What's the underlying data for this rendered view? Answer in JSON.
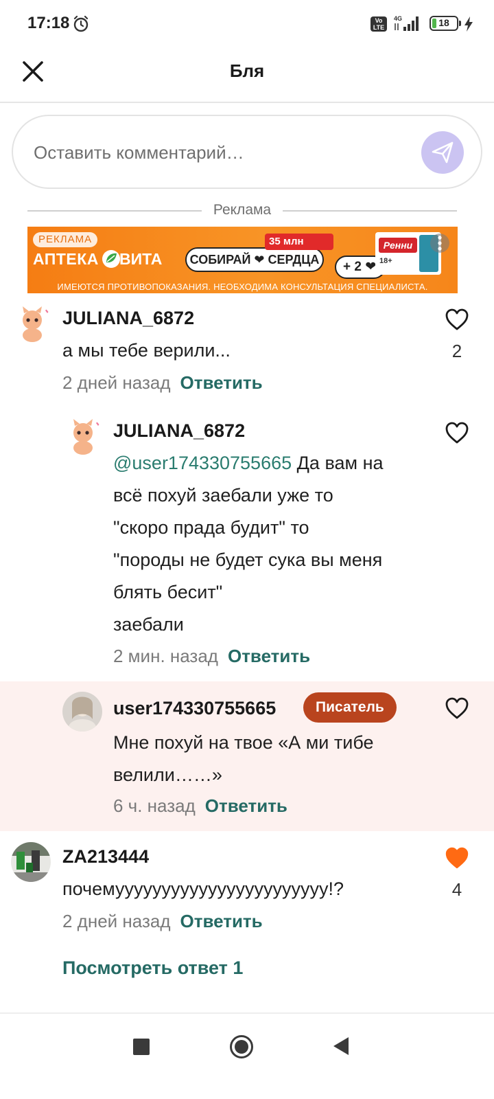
{
  "status_bar": {
    "time": "17:18",
    "network": "4G",
    "volte": "Vo LTE",
    "battery": "18",
    "battery_level": 0.18
  },
  "header": {
    "title": "Бля"
  },
  "comment_input": {
    "placeholder": "Оставить комментарий…"
  },
  "ad": {
    "caption": "Реклама",
    "badge": "РЕКЛАМА",
    "brand_left": "АПТЕКА",
    "brand_right": "ВИТА",
    "promo": "35 млн",
    "collect": "СОБИРАЙ ❤ СЕРДЦА",
    "plus": "+ 2 ❤",
    "product": "Ренни",
    "age": "18+",
    "disclaimer": "ИМЕЮТСЯ ПРОТИВОПОКАЗАНИЯ. НЕОБХОДИМА КОНСУЛЬТАЦИЯ СПЕЦИАЛИСТА."
  },
  "comments": [
    {
      "username": "JULIANA_6872",
      "text": "а мы тебе верили...",
      "time": "2 дней назад",
      "reply": "Ответить",
      "likes": "2"
    },
    {
      "username": "JULIANA_6872",
      "mention": "@user174330755665",
      "text_lines": [
        " Да вам на",
        "всё похуй заебали уже то",
        "\"скоро прада будит\" то",
        "\"породы не будет сука вы меня",
        "блять бесит\"",
        "заебали"
      ],
      "time": "2 мин. назад",
      "reply": "Ответить"
    },
    {
      "username": "user174330755665",
      "badge": "Писатель",
      "text_lines": [
        "Мне похуй на твое «А ми тибе",
        "велили……»"
      ],
      "time": "6 ч. назад",
      "reply": "Ответить"
    },
    {
      "username": "ZA213444",
      "text": "почемууууууууууууууууууууууу!?",
      "time": "2 дней назад",
      "reply": "Ответить",
      "likes": "4"
    }
  ],
  "view_replies": "Посмотреть ответ 1",
  "colors": {
    "accent": "#256a64",
    "liked": "#ff6a13",
    "writer_badge": "#b9441e",
    "send": "#cbc4f2",
    "highlight": "#fdf1ef"
  }
}
